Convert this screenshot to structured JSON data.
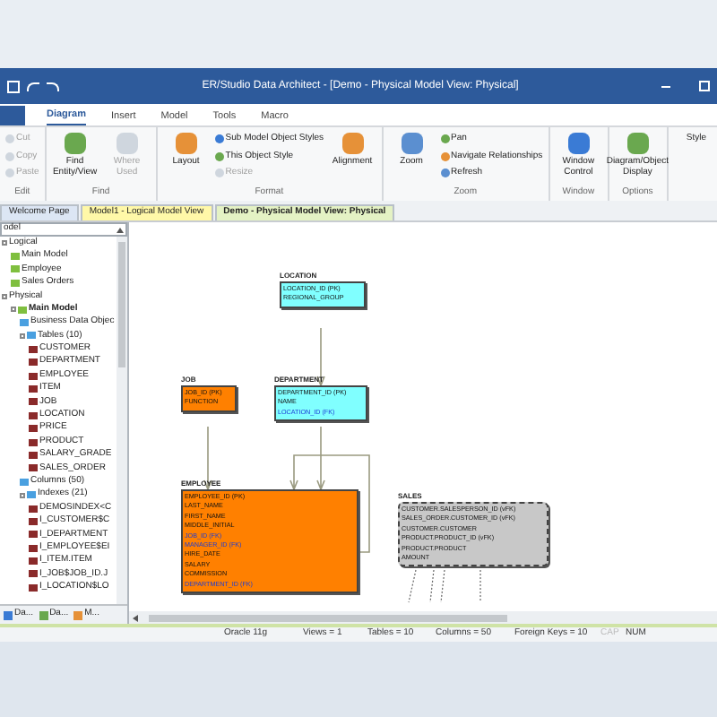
{
  "window": {
    "title": "ER/Studio Data Architect - [Demo - Physical Model View: Physical]"
  },
  "ribbon_tabs": [
    {
      "label": "Diagram",
      "selected": true
    },
    {
      "label": "Insert",
      "selected": false
    },
    {
      "label": "Model",
      "selected": false
    },
    {
      "label": "Tools",
      "selected": false
    },
    {
      "label": "Macro",
      "selected": false
    }
  ],
  "ribbon_right_label": "Style",
  "ribbon_groups": [
    {
      "label": "Edit",
      "items": [
        {
          "kind": "small",
          "label": "Cut",
          "disabled": true
        },
        {
          "kind": "small",
          "label": "Copy",
          "disabled": true
        },
        {
          "kind": "small",
          "label": "Paste",
          "disabled": true
        }
      ]
    },
    {
      "label": "Find",
      "items": [
        {
          "kind": "large",
          "label": "Find Entity/View",
          "disabled": false
        },
        {
          "kind": "large",
          "label": "Where Used",
          "disabled": true
        }
      ]
    },
    {
      "label": "Format",
      "items": [
        {
          "kind": "large",
          "label": "Layout",
          "disabled": false
        },
        {
          "kind": "small",
          "label": "Sub Model Object Styles",
          "disabled": false
        },
        {
          "kind": "small",
          "label": "This Object Style",
          "disabled": false
        },
        {
          "kind": "small",
          "label": "Resize",
          "disabled": true
        },
        {
          "kind": "large",
          "label": "Alignment",
          "disabled": false
        }
      ]
    },
    {
      "label": "Zoom",
      "items": [
        {
          "kind": "large",
          "label": "Zoom",
          "disabled": false
        },
        {
          "kind": "small",
          "label": "Pan",
          "disabled": false
        },
        {
          "kind": "small",
          "label": "Navigate Relationships",
          "disabled": false
        },
        {
          "kind": "small",
          "label": "Refresh",
          "disabled": false
        }
      ]
    },
    {
      "label": "Window",
      "items": [
        {
          "kind": "large",
          "label": "Window Control",
          "disabled": false
        }
      ]
    },
    {
      "label": "Options",
      "items": [
        {
          "kind": "large",
          "label": "Diagram/Object Display",
          "disabled": false
        }
      ]
    }
  ],
  "doc_tabs": [
    {
      "label": "Welcome Page",
      "selected": false,
      "color": "#dce6f4"
    },
    {
      "label": "Model1 - Logical Model View",
      "selected": false,
      "color": "#fff8a8"
    },
    {
      "label": "Demo - Physical Model View: Physical",
      "selected": true,
      "color": "#e4f2c4"
    }
  ],
  "explorer": {
    "dropdown_value": "odel",
    "tree": [
      {
        "label": "Logical",
        "children": [
          {
            "label": "Main Model"
          },
          {
            "label": "Employee"
          },
          {
            "label": "Sales Orders"
          }
        ]
      },
      {
        "label": "Physical",
        "children": [
          {
            "label": "Main Model",
            "bold": true,
            "children": [
              {
                "label": "Business Data Objec"
              },
              {
                "label": "Tables (10)",
                "children": [
                  {
                    "label": "CUSTOMER"
                  },
                  {
                    "label": "DEPARTMENT"
                  },
                  {
                    "label": "EMPLOYEE"
                  },
                  {
                    "label": "ITEM"
                  },
                  {
                    "label": "JOB"
                  },
                  {
                    "label": "LOCATION"
                  },
                  {
                    "label": "PRICE"
                  },
                  {
                    "label": "PRODUCT"
                  },
                  {
                    "label": "SALARY_GRADE"
                  },
                  {
                    "label": "SALES_ORDER"
                  }
                ]
              },
              {
                "label": "Columns (50)"
              },
              {
                "label": "Indexes (21)",
                "children": [
                  {
                    "label": "DEMOSINDEX<C"
                  },
                  {
                    "label": "I_CUSTOMER$C"
                  },
                  {
                    "label": "I_DEPARTMENT"
                  },
                  {
                    "label": "I_EMPLOYEE$EI"
                  },
                  {
                    "label": "I_ITEM.ITEM"
                  },
                  {
                    "label": "I_JOB$JOB_ID.J"
                  },
                  {
                    "label": "I_LOCATION$LO"
                  }
                ]
              }
            ]
          }
        ]
      }
    ],
    "bottom_tabs": [
      "Da...",
      "Da...",
      "M..."
    ]
  },
  "entities": [
    {
      "name": "LOCATION",
      "color": "#80ffff",
      "kind": "table",
      "attributes": [
        {
          "text": "LOCATION_ID (PK)",
          "foreign_key": false
        },
        {
          "text": "REGIONAL_GROUP",
          "foreign_key": false
        }
      ]
    },
    {
      "name": "JOB",
      "color": "#ff8000",
      "kind": "table",
      "attributes": [
        {
          "text": "JOB_ID (PK)",
          "foreign_key": false
        },
        {
          "text": "FUNCTION",
          "foreign_key": false
        }
      ]
    },
    {
      "name": "DEPARTMENT",
      "color": "#80ffff",
      "kind": "table",
      "attributes": [
        {
          "text": "DEPARTMENT_ID (PK)",
          "foreign_key": false
        },
        {
          "text": "NAME",
          "foreign_key": false
        },
        {
          "text": "LOCATION_ID (FK)",
          "foreign_key": true
        }
      ]
    },
    {
      "name": "EMPLOYEE",
      "color": "#ff8000",
      "kind": "table",
      "attributes": [
        {
          "text": "EMPLOYEE_ID (PK)",
          "foreign_key": false
        },
        {
          "text": "LAST_NAME",
          "foreign_key": false
        },
        {
          "text": "FIRST_NAME",
          "foreign_key": false
        },
        {
          "text": "MIDDLE_INITIAL",
          "foreign_key": false
        },
        {
          "text": "JOB_ID (FK)",
          "foreign_key": true
        },
        {
          "text": "MANAGER_ID (FK)",
          "foreign_key": true
        },
        {
          "text": "HIRE_DATE",
          "foreign_key": false
        },
        {
          "text": "SALARY",
          "foreign_key": false
        },
        {
          "text": "COMMISSION",
          "foreign_key": false
        },
        {
          "text": "DEPARTMENT_ID (FK)",
          "foreign_key": true
        }
      ]
    },
    {
      "name": "SALES",
      "color": "#c8c8c8",
      "kind": "view",
      "attributes": [
        {
          "text": "CUSTOMER.SALESPERSON_ID (vFK)",
          "foreign_key": false
        },
        {
          "text": "SALES_ORDER.CUSTOMER_ID (vFK)",
          "foreign_key": false
        },
        {
          "text": "CUSTOMER.CUSTOMER",
          "foreign_key": false
        },
        {
          "text": "PRODUCT.PRODUCT_ID (vFK)",
          "foreign_key": false
        },
        {
          "text": "PRODUCT.PRODUCT",
          "foreign_key": false
        },
        {
          "text": "AMOUNT",
          "foreign_key": false
        }
      ]
    }
  ],
  "status_bar": [
    {
      "text": "Oracle 11g",
      "enabled": true
    },
    {
      "text": "Views = 1",
      "enabled": true
    },
    {
      "text": "Tables = 10",
      "enabled": true
    },
    {
      "text": "Columns = 50",
      "enabled": true
    },
    {
      "text": "Foreign Keys = 10",
      "enabled": true
    },
    {
      "text": "CAP",
      "enabled": false
    },
    {
      "text": "NUM",
      "enabled": true
    }
  ]
}
